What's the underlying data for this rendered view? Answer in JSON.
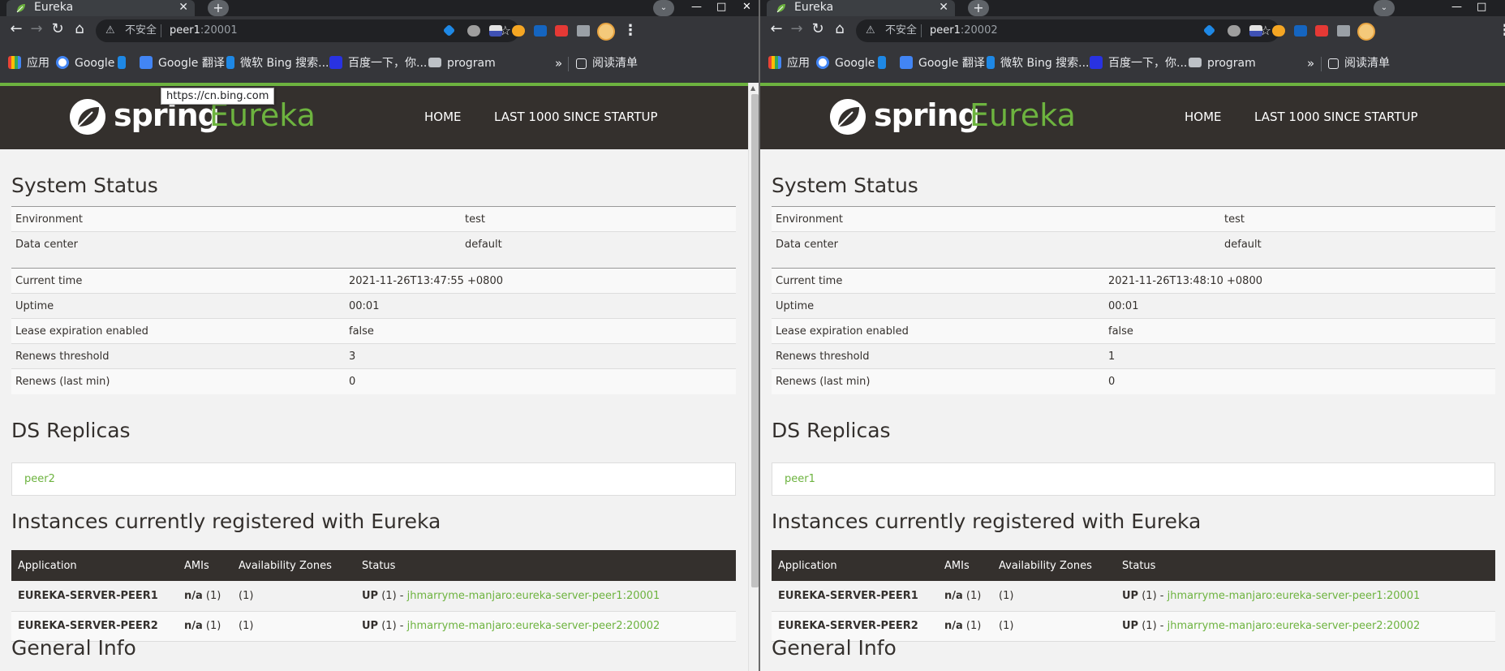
{
  "windows": [
    {
      "tab_title": "Eureka",
      "address": {
        "insecure_label": "不安全",
        "host": "peer1",
        "port": ":20001"
      },
      "bookmarks": [
        "应用",
        "Google",
        "Google 翻译",
        "微软 Bing 搜索...",
        "百度一下，你...",
        "program"
      ],
      "reading_list": "阅读清单",
      "tooltip": "https://cn.bing.com",
      "nav": {
        "home": "HOME",
        "last": "LAST 1000 SINCE STARTUP"
      },
      "brand": {
        "spring": "spring",
        "eureka": "Eureka"
      },
      "system_status_title": "System Status",
      "env_rows": [
        [
          "Environment",
          "test"
        ],
        [
          "Data center",
          "default"
        ]
      ],
      "status_rows": [
        [
          "Current time",
          "2021-11-26T13:47:55 +0800"
        ],
        [
          "Uptime",
          "00:01"
        ],
        [
          "Lease expiration enabled",
          "false"
        ],
        [
          "Renews threshold",
          "3"
        ],
        [
          "Renews (last min)",
          "0"
        ]
      ],
      "ds_replicas_title": "DS Replicas",
      "replica": "peer2",
      "instances_title": "Instances currently registered with Eureka",
      "instance_headers": [
        "Application",
        "AMIs",
        "Availability Zones",
        "Status"
      ],
      "instances": [
        {
          "app": "EUREKA-SERVER-PEER1",
          "ami": "n/a",
          "ami_count": "(1)",
          "zones": "(1)",
          "status": "UP",
          "status_count": "(1) -",
          "link": "jhmarryme-manjaro:eureka-server-peer1:20001"
        },
        {
          "app": "EUREKA-SERVER-PEER2",
          "ami": "n/a",
          "ami_count": "(1)",
          "zones": "(1)",
          "status": "UP",
          "status_count": "(1) -",
          "link": "jhmarryme-manjaro:eureka-server-peer2:20002"
        }
      ],
      "general_info_title": "General Info"
    },
    {
      "tab_title": "Eureka",
      "address": {
        "insecure_label": "不安全",
        "host": "peer1",
        "port": ":20002"
      },
      "bookmarks": [
        "应用",
        "Google",
        "Google 翻译",
        "微软 Bing 搜索...",
        "百度一下，你...",
        "program"
      ],
      "reading_list": "阅读清单",
      "nav": {
        "home": "HOME",
        "last": "LAST 1000 SINCE STARTUP"
      },
      "brand": {
        "spring": "spring",
        "eureka": "Eureka"
      },
      "system_status_title": "System Status",
      "env_rows": [
        [
          "Environment",
          "test"
        ],
        [
          "Data center",
          "default"
        ]
      ],
      "status_rows": [
        [
          "Current time",
          "2021-11-26T13:48:10 +0800"
        ],
        [
          "Uptime",
          "00:01"
        ],
        [
          "Lease expiration enabled",
          "false"
        ],
        [
          "Renews threshold",
          "1"
        ],
        [
          "Renews (last min)",
          "0"
        ]
      ],
      "ds_replicas_title": "DS Replicas",
      "replica": "peer1",
      "instances_title": "Instances currently registered with Eureka",
      "instance_headers": [
        "Application",
        "AMIs",
        "Availability Zones",
        "Status"
      ],
      "instances": [
        {
          "app": "EUREKA-SERVER-PEER1",
          "ami": "n/a",
          "ami_count": "(1)",
          "zones": "(1)",
          "status": "UP",
          "status_count": "(1) -",
          "link": "jhmarryme-manjaro:eureka-server-peer1:20001"
        },
        {
          "app": "EUREKA-SERVER-PEER2",
          "ami": "n/a",
          "ami_count": "(1)",
          "zones": "(1)",
          "status": "UP",
          "status_count": "(1) -",
          "link": "jhmarryme-manjaro:eureka-server-peer2:20002"
        }
      ],
      "general_info_title": "General Info"
    }
  ],
  "icons": [
    "leaf-favicon",
    "close-icon",
    "plus-icon",
    "back-arrow-icon",
    "forward-arrow-icon",
    "reload-icon",
    "home-icon",
    "warning-icon",
    "star-icon",
    "puzzle-icon",
    "kebab-menu-icon",
    "apps-grid-icon",
    "folder-icon",
    "reading-list-icon"
  ],
  "colors": {
    "spring_green": "#6db33f",
    "navbar": "#34302d",
    "chrome_dark": "#35363a"
  }
}
